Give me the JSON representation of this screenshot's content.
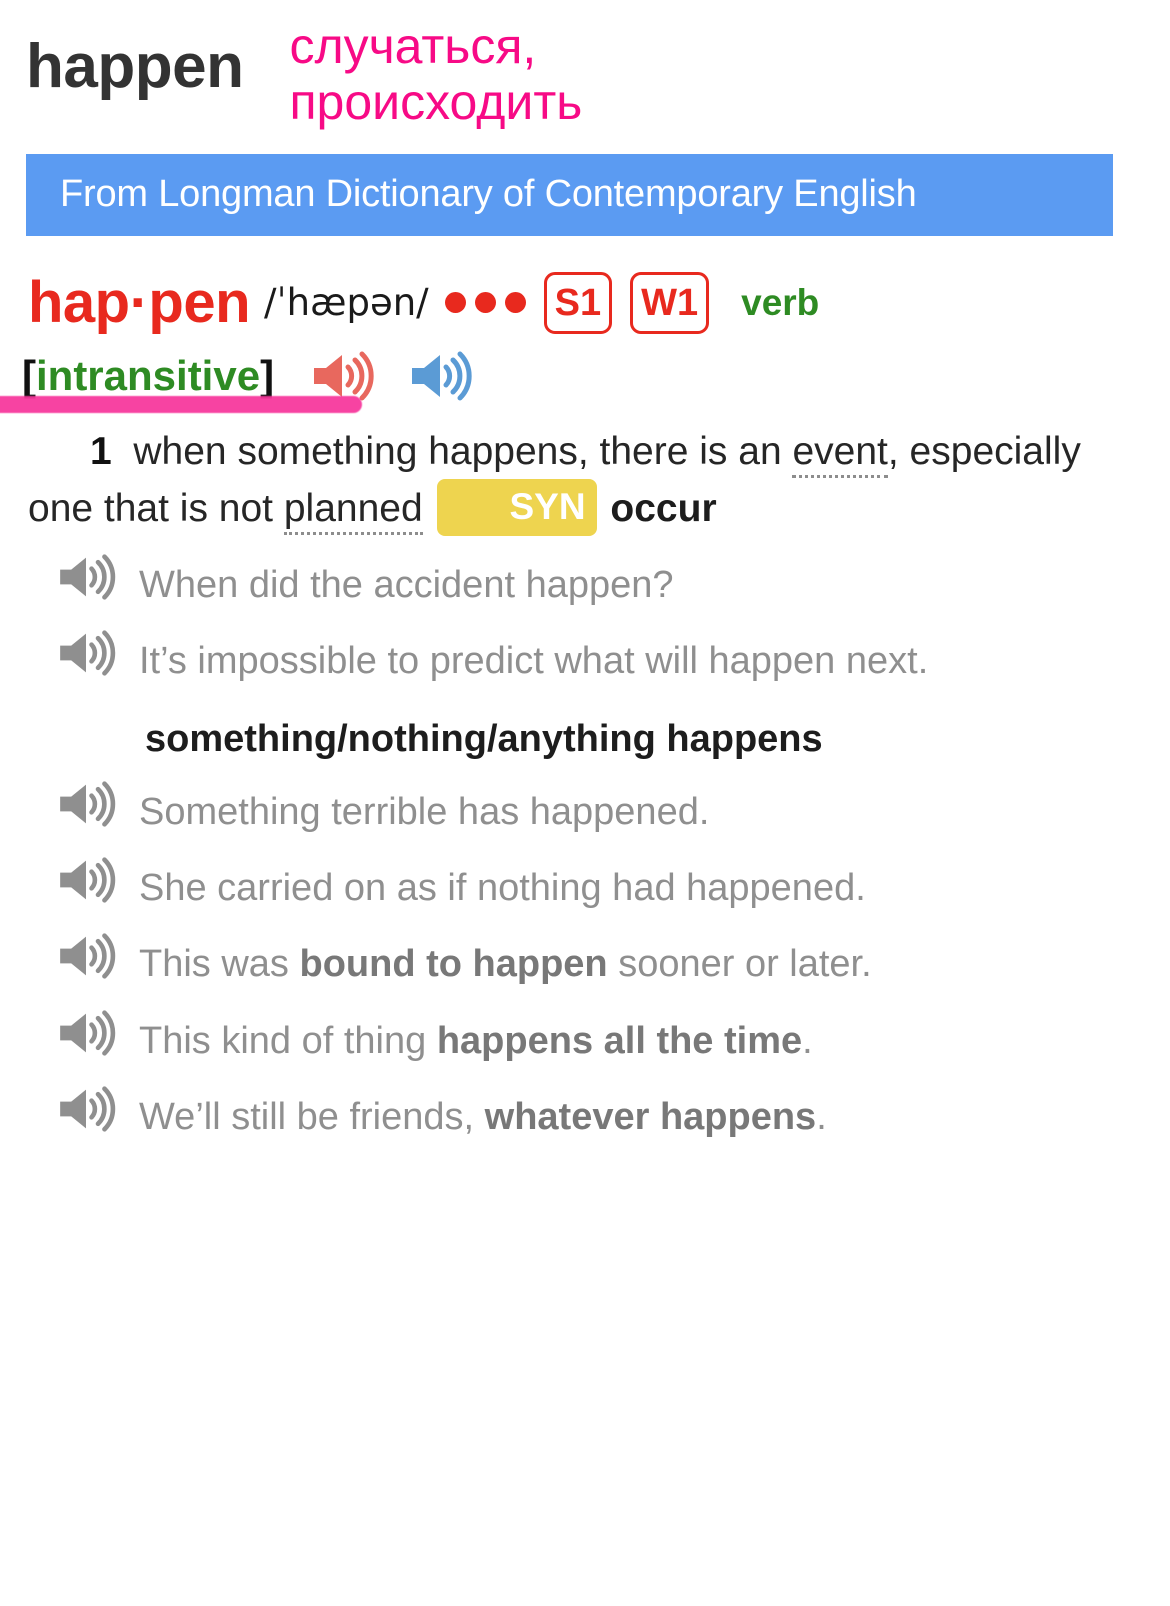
{
  "header": {
    "headword_en": "happen",
    "translation_ru": "случаться, происходить",
    "source_banner": "From Longman Dictionary of Contemporary English",
    "banner_color": "#5b9bf2",
    "translation_color": "#f70a86"
  },
  "entry": {
    "headword_syllabified": "hap·pen",
    "headword_color": "#e8291e",
    "ipa": "/ˈhæpən/",
    "frequency_dots": 3,
    "rank_badges": [
      "S1",
      "W1"
    ],
    "part_of_speech": "verb",
    "pos_color": "#2e8b23",
    "grammar_bracket_open": "[",
    "grammar_label": "intransitive",
    "grammar_bracket_close": "]",
    "highlight_color": "#f7359b",
    "audio": [
      {
        "name": "british-pronunciation",
        "color": "#e8685e"
      },
      {
        "name": "american-pronunciation",
        "color": "#5b9bd5"
      }
    ]
  },
  "sense": {
    "number": "1",
    "definition_part1": "when something happens, there is an ",
    "definition_link1": "event",
    "definition_part2": ", especially one that is not ",
    "definition_link2": "planned",
    "syn_label": "SYN",
    "syn_badge_color": "#eed44f",
    "syn_word": "occur"
  },
  "examples": [
    {
      "text_before": "When did the accident happen?",
      "bold": "",
      "text_after": ""
    },
    {
      "text_before": "It’s impossible to predict what will happen next.",
      "bold": "",
      "text_after": ""
    }
  ],
  "collocation": {
    "heading": "something/nothing/anything happens",
    "examples": [
      {
        "text_before": "Something terrible has happened.",
        "bold": "",
        "text_after": ""
      },
      {
        "text_before": "She carried on as if nothing had happened.",
        "bold": "",
        "text_after": ""
      },
      {
        "text_before": "This was ",
        "bold": "bound to happen",
        "text_after": " sooner or later."
      },
      {
        "text_before": "This kind of thing ",
        "bold": "happens all the time",
        "text_after": "."
      },
      {
        "text_before": "We’ll still be friends, ",
        "bold": "whatever happens",
        "text_after": "."
      }
    ]
  }
}
